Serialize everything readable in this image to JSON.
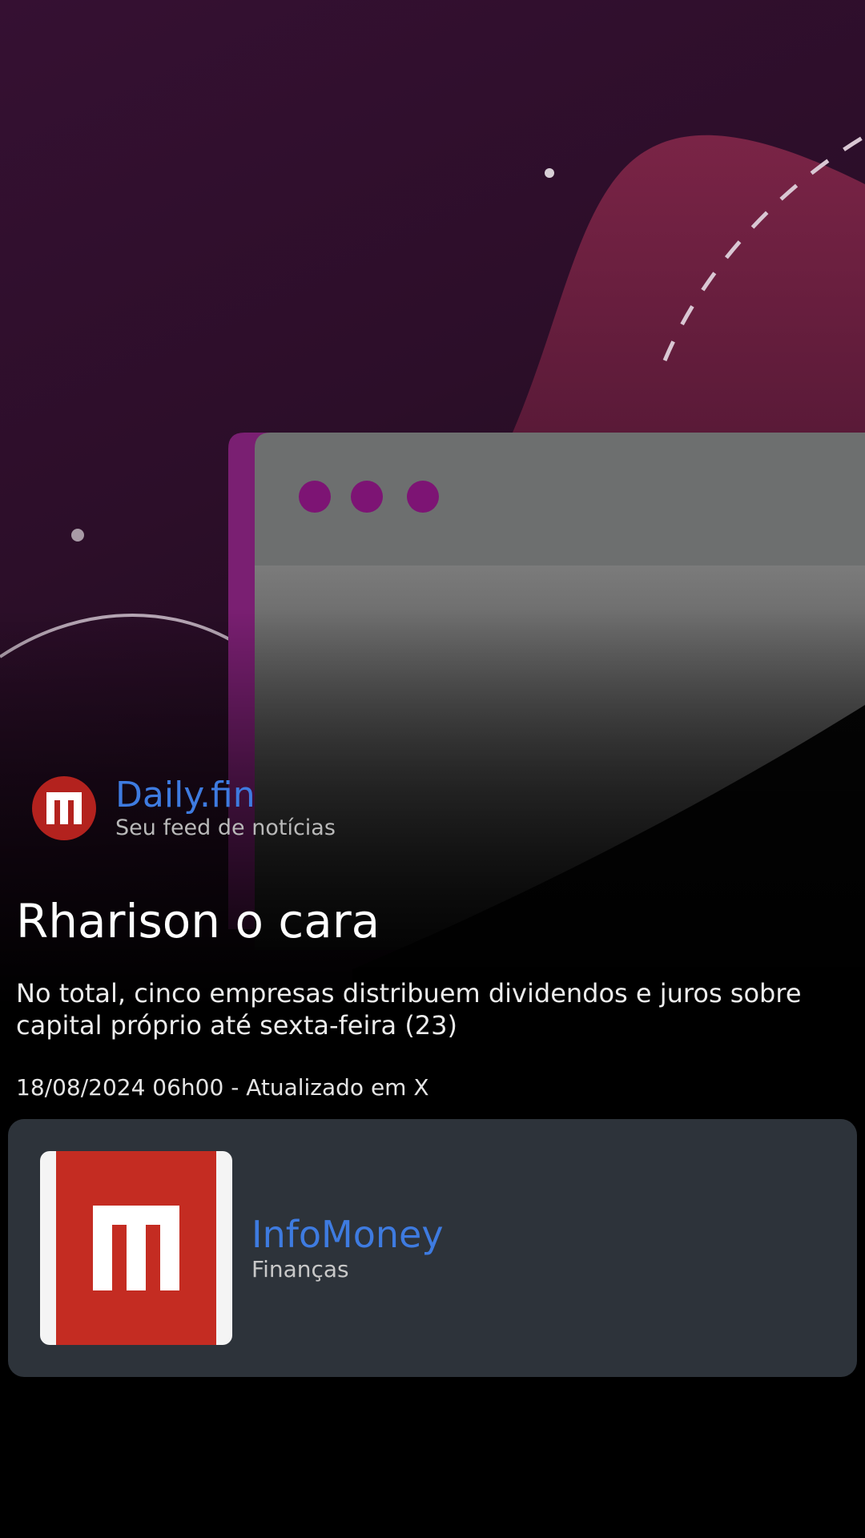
{
  "brand": {
    "name": "Daily.fin",
    "tagline": "Seu feed de notícias",
    "logo_icon": "infomoney-m-icon"
  },
  "article": {
    "headline": "Rharison o cara",
    "summary": "No total, cinco empresas distribuem dividendos e juros sobre capital próprio até sexta-feira (23)",
    "timestamp": "18/08/2024 06h00 - Atualizado em X",
    "hero_image": "browser-window-illustration"
  },
  "source": {
    "name": "InfoMoney",
    "category": "Finanças",
    "logo_icon": "infomoney-m-icon"
  },
  "colors": {
    "accent_blue": "#3e7be0",
    "logo_red": "#c42c22",
    "card_bg": "#2d333a",
    "hero_purple": "#3a1238",
    "hero_pink": "#7a2446"
  }
}
